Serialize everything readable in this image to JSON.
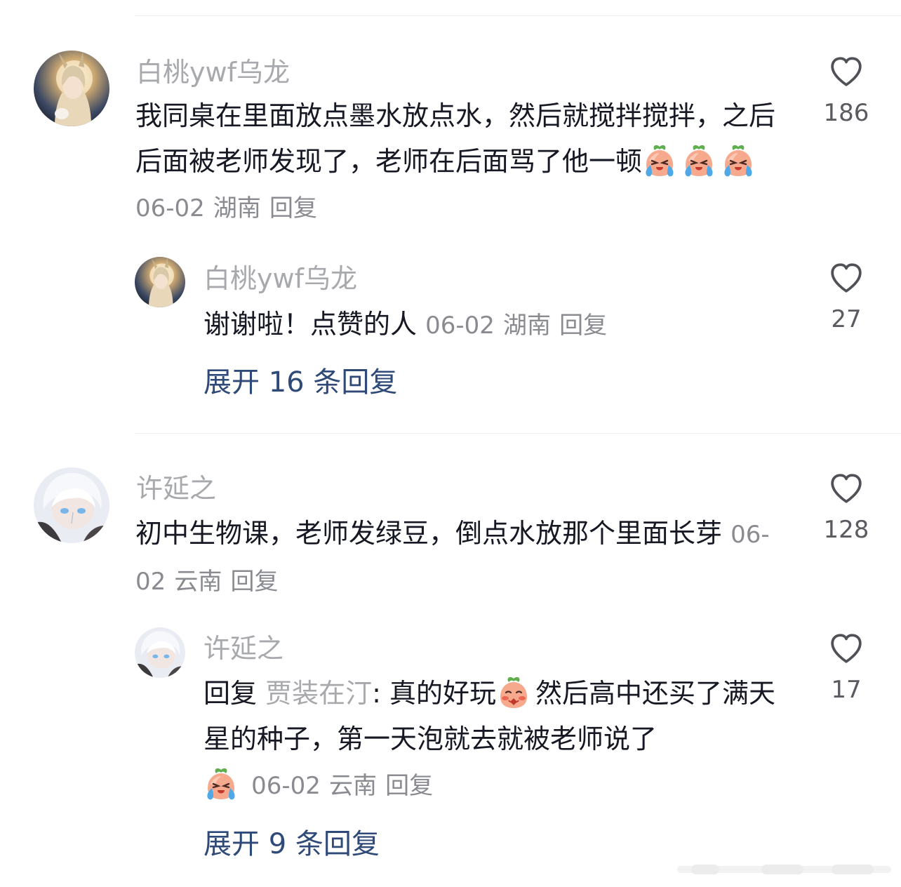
{
  "comments": [
    {
      "author": "白桃ywf乌龙",
      "text": "我同桌在里面放点墨水放点水，然后就搅拌搅拌，之后后面被老师发现了，老师在后面骂了他一顿",
      "emojis": [
        "crying-peach-emoji",
        "crying-peach-emoji",
        "crying-peach-emoji"
      ],
      "date": "06-02",
      "location": "湖南",
      "reply_label": "回复",
      "likes": "186",
      "reply": {
        "author": "白桃ywf乌龙",
        "text": "谢谢啦！点赞的人",
        "date": "06-02",
        "location": "湖南",
        "reply_label": "回复",
        "likes": "27"
      },
      "expand_label": "展开 16 条回复"
    },
    {
      "author": "许延之",
      "text": "初中生物课，老师发绿豆，倒点水放那个里面长芽",
      "date": "06-02",
      "location": "云南",
      "reply_label": "回复",
      "likes": "128",
      "reply": {
        "author": "许延之",
        "prefix": "回复",
        "target": "贾装在汀",
        "colon": ":",
        "text_part1": "真的好玩",
        "emoji1": "shy-peach-emoji",
        "text_part2": "然后高中还买了满天星的种子，第一天泡就去就被老师说了",
        "emoji2": "crying-peach-emoji",
        "date": "06-02",
        "location": "云南",
        "reply_label": "回复",
        "likes": "17"
      },
      "expand_label": "展开 9 条回复"
    }
  ],
  "colors": {
    "name_gray": "#a7a9ad",
    "meta_gray": "#8a8b91",
    "expand_blue": "#2f4a78",
    "text": "#161823"
  }
}
